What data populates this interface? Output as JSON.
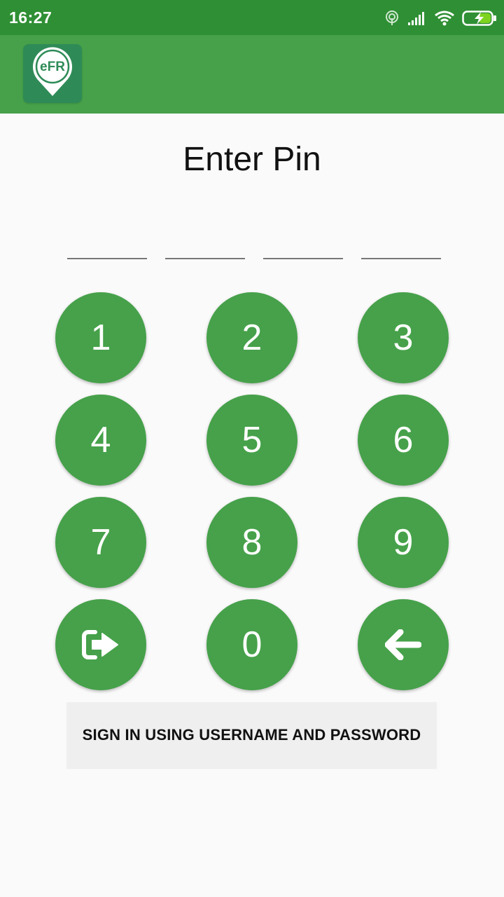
{
  "status_bar": {
    "time": "16:27",
    "icons": [
      "hotspot-icon",
      "signal-icon",
      "wifi-icon",
      "battery-charging-icon"
    ]
  },
  "app_bar": {
    "logo_text": "eFR",
    "logo_icon": "location-pin-icon",
    "color": "#46a14a"
  },
  "screen": {
    "title": "Enter Pin",
    "pin_length": 4
  },
  "keypad": {
    "keys": [
      "1",
      "2",
      "3",
      "4",
      "5",
      "6",
      "7",
      "8",
      "9",
      "0"
    ],
    "left_action_icon": "sign-in-icon",
    "right_action_icon": "backspace-arrow-icon",
    "key_color": "#46a14a"
  },
  "alt_signin": {
    "label": "SIGN IN USING USERNAME AND PASSWORD"
  },
  "colors": {
    "status_bar": "#2f8f34",
    "accent": "#46a14a",
    "logo_bg": "#2e8b57"
  }
}
